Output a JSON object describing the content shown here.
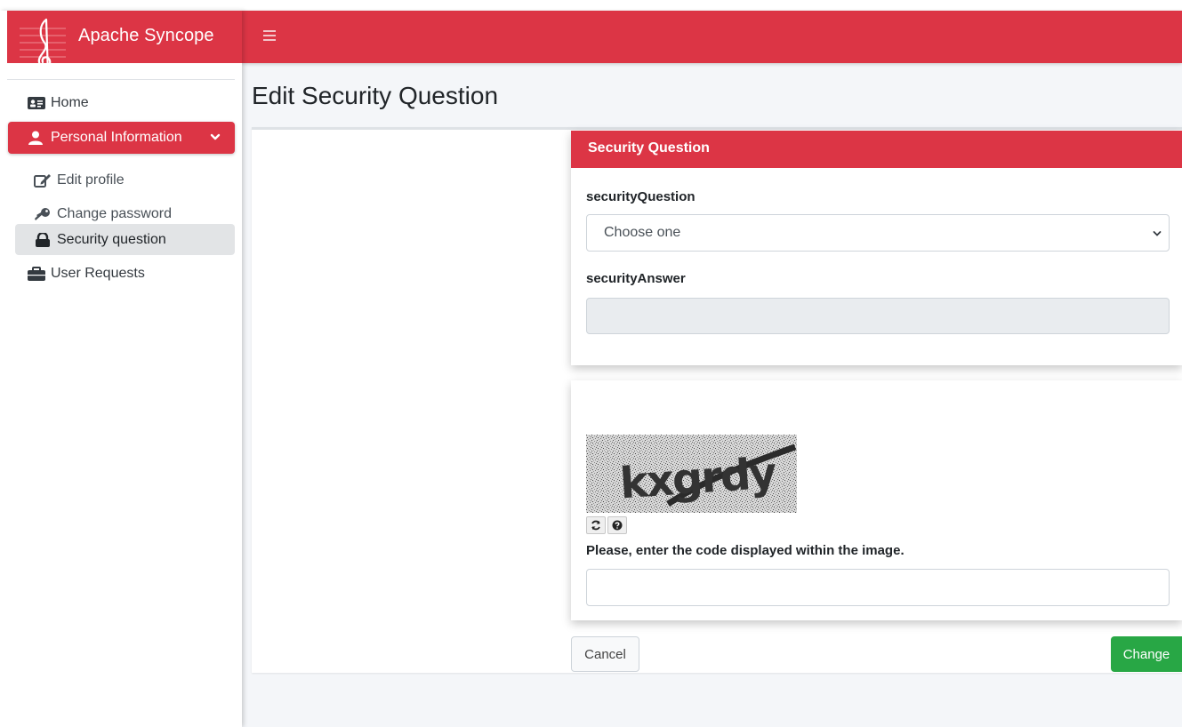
{
  "brand": {
    "name": "Apache Syncope",
    "logo_icon": "treble-clef-icon"
  },
  "topbar": {
    "menu_icon": "hamburger-icon"
  },
  "sidebar": {
    "home": "Home",
    "personal_information": "Personal Information",
    "edit_profile": "Edit profile",
    "change_password": "Change password",
    "security_question": "Security question",
    "user_requests": "User Requests"
  },
  "page": {
    "title": "Edit Security Question"
  },
  "security_panel": {
    "header": "Security Question",
    "question_label": "securityQuestion",
    "question_value": "Choose one",
    "answer_label": "securityAnswer",
    "answer_value": ""
  },
  "captcha": {
    "image_text": "kxgrdy",
    "instructions": "Please, enter the code displayed within the image.",
    "input_value": ""
  },
  "buttons": {
    "cancel": "Cancel",
    "change": "Change"
  },
  "colors": {
    "accent": "#dc3545",
    "success": "#28a745",
    "active_nav_bg": "#e2e4e6"
  }
}
